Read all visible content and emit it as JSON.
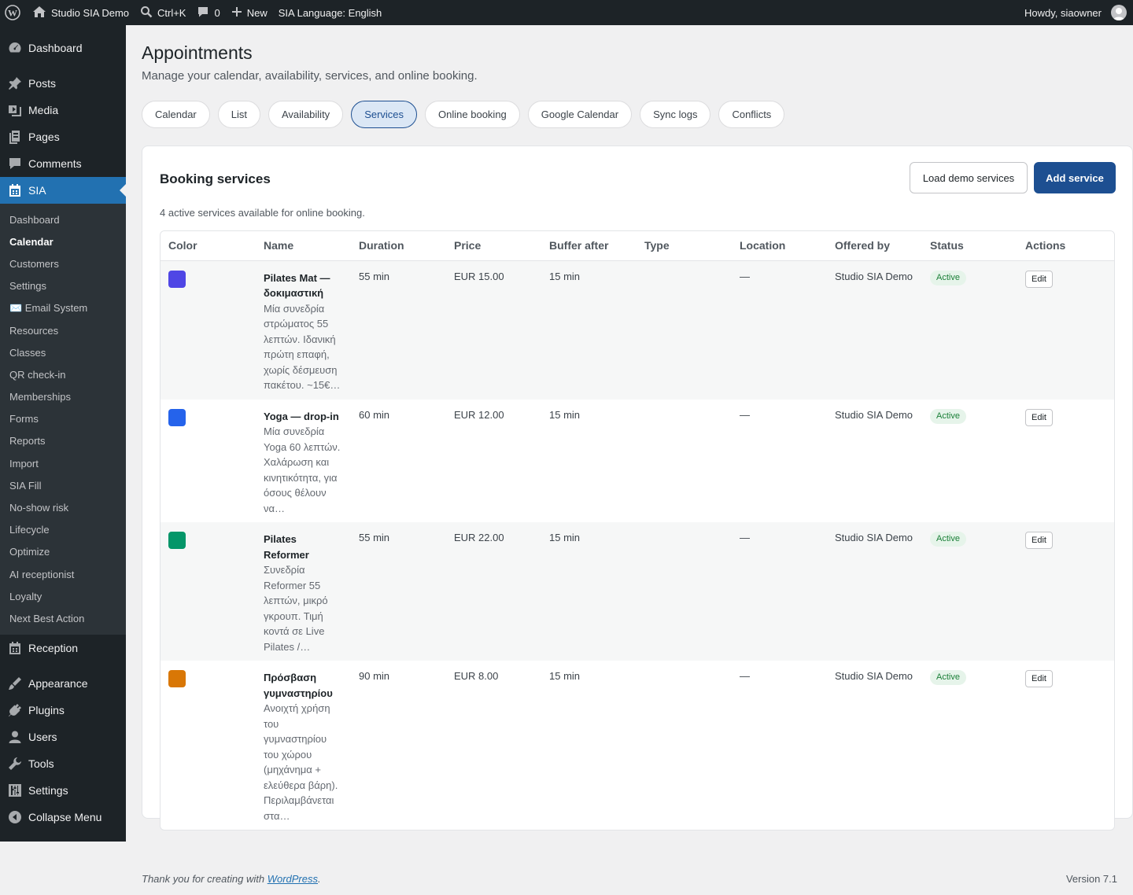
{
  "adminbar": {
    "site_name": "Studio SIA Demo",
    "search_shortcut": "Ctrl+K",
    "comments_count": "0",
    "new_label": "New",
    "language_label": "SIA Language: English",
    "howdy": "Howdy, siaowner"
  },
  "sidebar": {
    "top_items": [
      {
        "label": "Dashboard",
        "icon": "dashboard-icon"
      },
      {
        "label": "Posts",
        "icon": "pin-icon"
      },
      {
        "label": "Media",
        "icon": "media-icon"
      },
      {
        "label": "Pages",
        "icon": "pages-icon"
      },
      {
        "label": "Comments",
        "icon": "comment-icon"
      },
      {
        "label": "SIA",
        "icon": "calendar-icon"
      }
    ],
    "sia_submenu": [
      "Dashboard",
      "Calendar",
      "Customers",
      "Settings",
      "✉️ Email System",
      "Resources",
      "Classes",
      "QR check-in",
      "Memberships",
      "Forms",
      "Reports",
      "Import",
      "SIA Fill",
      "No-show risk",
      "Lifecycle",
      "Optimize",
      "AI receptionist",
      "Loyalty",
      "Next Best Action"
    ],
    "active_sub": "Calendar",
    "bottom_items": [
      {
        "label": "Reception",
        "icon": "calendar-icon"
      },
      {
        "label": "Appearance",
        "icon": "brush-icon"
      },
      {
        "label": "Plugins",
        "icon": "plug-icon"
      },
      {
        "label": "Users",
        "icon": "user-icon"
      },
      {
        "label": "Tools",
        "icon": "wrench-icon"
      },
      {
        "label": "Settings",
        "icon": "sliders-icon"
      },
      {
        "label": "Collapse Menu",
        "icon": "collapse-icon"
      }
    ]
  },
  "page": {
    "title": "Appointments",
    "subtitle": "Manage your calendar, availability, services, and online booking.",
    "tabs": [
      "Calendar",
      "List",
      "Availability",
      "Services",
      "Online booking",
      "Google Calendar",
      "Sync logs",
      "Conflicts"
    ],
    "active_tab": "Services"
  },
  "services": {
    "title": "Booking services",
    "load_demo_label": "Load demo services",
    "add_label": "Add service",
    "count_note": "4 active services available for online booking.",
    "columns": [
      "Color",
      "Name",
      "Duration",
      "Price",
      "Buffer after",
      "Type",
      "Location",
      "Offered by",
      "Status",
      "Actions"
    ],
    "rows": [
      {
        "color": "#4f46e5",
        "name": "Pilates Mat — δοκιμαστική",
        "description": "Μία συνεδρία στρώματος 55 λεπτών. Ιδανική πρώτη επαφή, χωρίς δέσμευση πακέτου. ~15€…",
        "duration": "55 min",
        "price": "EUR 15.00",
        "buffer": "15 min",
        "type": "",
        "location": "—",
        "offered_by": "Studio SIA Demo",
        "status": "Active",
        "action": "Edit"
      },
      {
        "color": "#2563eb",
        "name": "Yoga — drop-in",
        "description": "Μία συνεδρία Yoga 60 λεπτών. Χαλάρωση και κινητικότητα, για όσους θέλουν να…",
        "duration": "60 min",
        "price": "EUR 12.00",
        "buffer": "15 min",
        "type": "",
        "location": "—",
        "offered_by": "Studio SIA Demo",
        "status": "Active",
        "action": "Edit"
      },
      {
        "color": "#059669",
        "name": "Pilates Reformer",
        "description": "Συνεδρία Reformer 55 λεπτών, μικρό γκρουπ. Τιμή κοντά σε Live Pilates /…",
        "duration": "55 min",
        "price": "EUR 22.00",
        "buffer": "15 min",
        "type": "",
        "location": "—",
        "offered_by": "Studio SIA Demo",
        "status": "Active",
        "action": "Edit"
      },
      {
        "color": "#d97706",
        "name": "Πρόσβαση γυμναστηρίου",
        "description": "Ανοιχτή χρήση του γυμναστηρίου του χώρου (μηχάνημα + ελεύθερα βάρη). Περιλαμβάνεται στα…",
        "duration": "90 min",
        "price": "EUR 8.00",
        "buffer": "15 min",
        "type": "",
        "location": "—",
        "offered_by": "Studio SIA Demo",
        "status": "Active",
        "action": "Edit"
      }
    ]
  },
  "footer": {
    "thanks_prefix": "Thank you for creating with ",
    "thanks_link": "WordPress",
    "thanks_suffix": ".",
    "version": "Version 7.1"
  }
}
